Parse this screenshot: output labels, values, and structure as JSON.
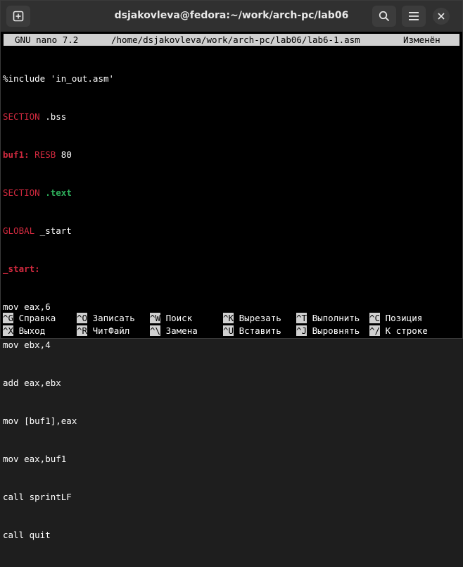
{
  "window": {
    "title": "dsjakovleva@fedora:~/work/arch-pc/lab06"
  },
  "nano": {
    "version": "GNU nano 7.2",
    "path": "/home/dsjakovleva/work/arch-pc/lab06/lab6-1.asm",
    "status": "Изменён"
  },
  "code": {
    "l1": "%include 'in_out.asm'",
    "l2_kw": "SECTION",
    "l2_rest": " .bss",
    "l3_label": "buf1:",
    "l3_kw": " RESB",
    "l3_rest": " 80",
    "l4_kw": "SECTION",
    "l4_rest": " .text",
    "l5_kw": "GLOBAL",
    "l5_rest": " _start",
    "l6": "_start:",
    "l7": "mov eax,6",
    "l8": "mov ebx,4",
    "l9": "add eax,ebx",
    "l10": "mov [buf1],eax",
    "l11": "mov eax,buf1",
    "l12": "call sprintLF",
    "l13": "call quit"
  },
  "shortcuts": {
    "row1": [
      {
        "key": "^G",
        "label": "Справка"
      },
      {
        "key": "^O",
        "label": "Записать"
      },
      {
        "key": "^W",
        "label": "Поиск"
      },
      {
        "key": "^K",
        "label": "Вырезать"
      },
      {
        "key": "^T",
        "label": "Выполнить"
      },
      {
        "key": "^C",
        "label": "Позиция"
      }
    ],
    "row2": [
      {
        "key": "^X",
        "label": "Выход"
      },
      {
        "key": "^R",
        "label": "ЧитФайл"
      },
      {
        "key": "^\\",
        "label": "Замена"
      },
      {
        "key": "^U",
        "label": "Вставить"
      },
      {
        "key": "^J",
        "label": "Выровнять"
      },
      {
        "key": "^/",
        "label": "К строке"
      }
    ]
  },
  "colors": {
    "keyword": "#d0293e",
    "text_section": "#2fb35d",
    "header_bg": "#d0d0d0"
  }
}
